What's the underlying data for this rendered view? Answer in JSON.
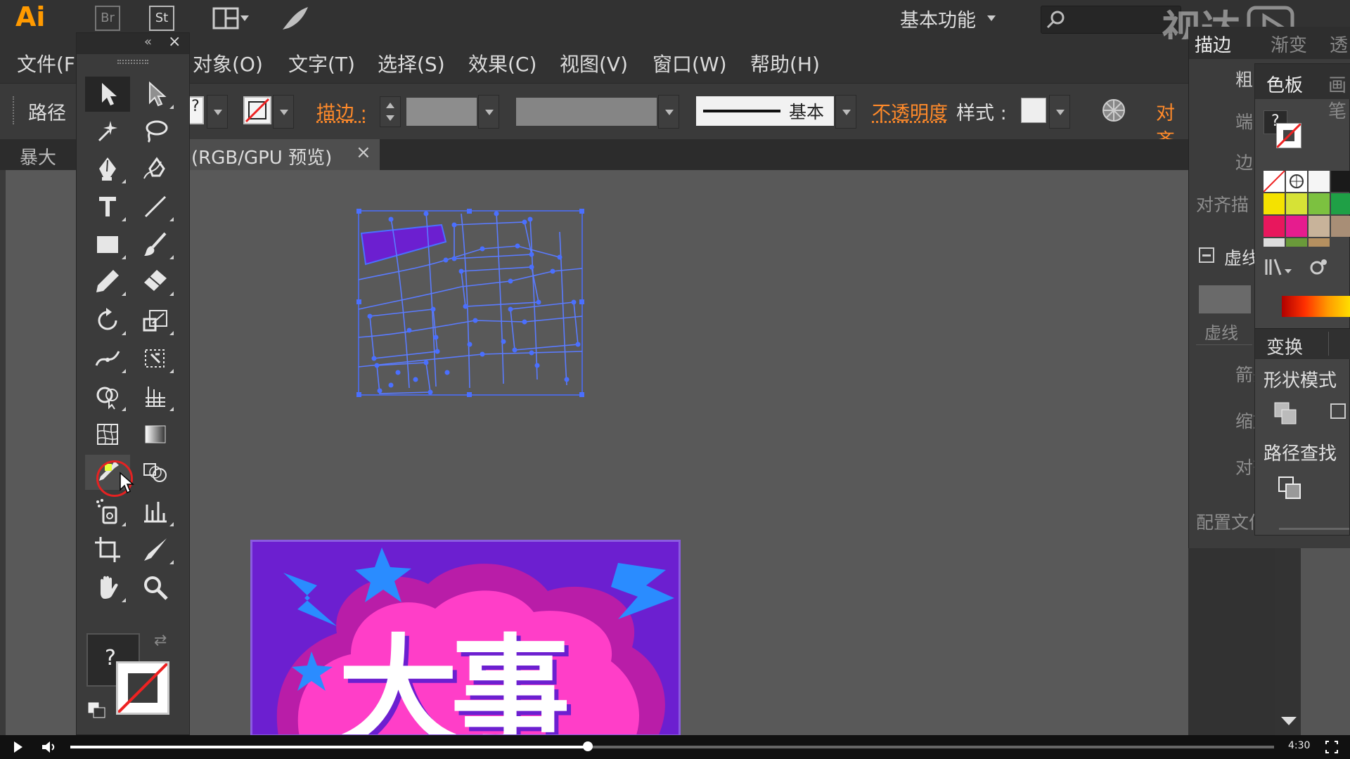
{
  "app": {
    "logo": "Ai",
    "bridge": "Br",
    "stock": "St",
    "workspace": "基本功能",
    "search_placeholder": ""
  },
  "menu": [
    "文件(F)",
    "对象(O)",
    "文字(T)",
    "选择(S)",
    "效果(C)",
    "视图(V)",
    "窗口(W)",
    "帮助(H)"
  ],
  "control_bar": {
    "selection_type": "路径",
    "stroke_label": "描边 :",
    "stroke_profile": "基本",
    "opacity_label": "不透明度",
    "style_label": "样式 :",
    "align_label": "对齐"
  },
  "document_tabs": {
    "tab1": "暴大事",
    "tab2": "(RGB/GPU 预览)",
    "close": "×"
  },
  "toolbox": {
    "question_mark": "?"
  },
  "right_panel": {
    "stroke_tab": "描边",
    "gradient_tab": "渐变",
    "transparency_tab": "透",
    "weight": "粗",
    "cap": "端",
    "corner": "边",
    "align_stroke": "对齐描",
    "dashed_line": "虚线",
    "dash": "虚线",
    "arrowheads": "箭头",
    "scale": "缩放",
    "align": "对齐",
    "profile": "配置文件",
    "swatches_tab": "色板",
    "brushes_tab": "画笔",
    "transform_tab": "变换",
    "shape_modes": "形状模式",
    "pathfinder": "路径查找",
    "question_mark": "?"
  },
  "poster": {
    "headline": "大事"
  },
  "video": {
    "time": "4:30",
    "progress_fraction": 0.43,
    "watermark": "视达"
  },
  "colors": {
    "accent_orange": "#ff8a2a",
    "selection_blue": "#4a6fff",
    "poster_purple": "#6c1fd0",
    "poster_pink": "#ff3ec8"
  }
}
